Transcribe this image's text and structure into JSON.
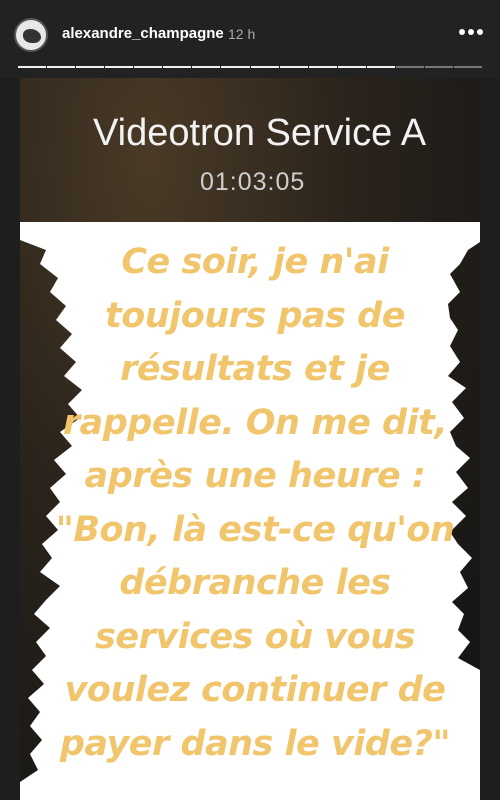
{
  "header": {
    "username": "alexandre_champagne",
    "time": "12 h",
    "more_icon": "more-dots-icon",
    "progress_segments_total": 16,
    "progress_segments_viewed": 13
  },
  "call": {
    "contact_name": "Videotron Service A",
    "duration": "01:03:05"
  },
  "message": {
    "lines": [
      "Ce soir, je n'ai",
      "toujours pas de",
      "résultats et je",
      "rappelle. On me dit,",
      "après une heure :",
      "\"Bon, là est-ce qu'on",
      "débranche les",
      "services où vous",
      "voulez continuer de",
      "payer dans le vide?\""
    ]
  },
  "colors": {
    "text_accent": "#f1c56b",
    "highlight": "#ffffff"
  }
}
